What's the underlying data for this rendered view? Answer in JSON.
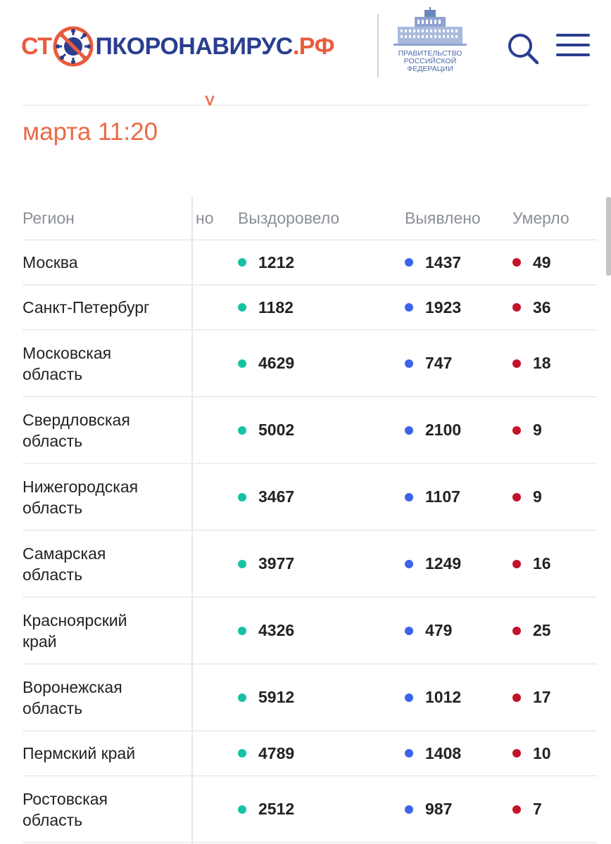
{
  "header": {
    "logo_part1": "СТ",
    "logo_part2": "ПКОРОНАВИРУС",
    "logo_part3": ".РФ",
    "gov_text": [
      "ПРАВИТЕЛЬСТВО",
      "РОССИЙСКОЙ",
      "ФЕДЕРАЦИИ"
    ],
    "search_icon": "search-icon",
    "menu_icon": "hamburger-menu-icon"
  },
  "update_time": "марта 11:20",
  "colors": {
    "accent_orange": "#ea5b3a",
    "brand_blue": "#2a3e8f",
    "recovered": "#16c2a3",
    "detected": "#3c64e8",
    "deaths": "#c4122b"
  },
  "table": {
    "headers": {
      "region": "Регион",
      "hidden": "но",
      "recovered": "Выздоровело",
      "detected": "Выявлено",
      "deaths": "Умерло"
    },
    "rows": [
      {
        "region": [
          "Москва"
        ],
        "recovered": "1212",
        "detected": "1437",
        "deaths": "49"
      },
      {
        "region": [
          "Санкт-Петербург"
        ],
        "recovered": "1182",
        "detected": "1923",
        "deaths": "36"
      },
      {
        "region": [
          "Московская",
          "область"
        ],
        "recovered": "4629",
        "detected": "747",
        "deaths": "18"
      },
      {
        "region": [
          "Свердловская",
          "область"
        ],
        "recovered": "5002",
        "detected": "2100",
        "deaths": "9"
      },
      {
        "region": [
          "Нижегородская",
          "область"
        ],
        "recovered": "3467",
        "detected": "1107",
        "deaths": "9"
      },
      {
        "region": [
          "Самарская",
          "область"
        ],
        "recovered": "3977",
        "detected": "1249",
        "deaths": "16"
      },
      {
        "region": [
          "Красноярский",
          "край"
        ],
        "recovered": "4326",
        "detected": "479",
        "deaths": "25"
      },
      {
        "region": [
          "Воронежская",
          "область"
        ],
        "recovered": "5912",
        "detected": "1012",
        "deaths": "17"
      },
      {
        "region": [
          "Пермский край"
        ],
        "recovered": "4789",
        "detected": "1408",
        "deaths": "10"
      },
      {
        "region": [
          "Ростовская",
          "область"
        ],
        "recovered": "2512",
        "detected": "987",
        "deaths": "7"
      }
    ]
  }
}
